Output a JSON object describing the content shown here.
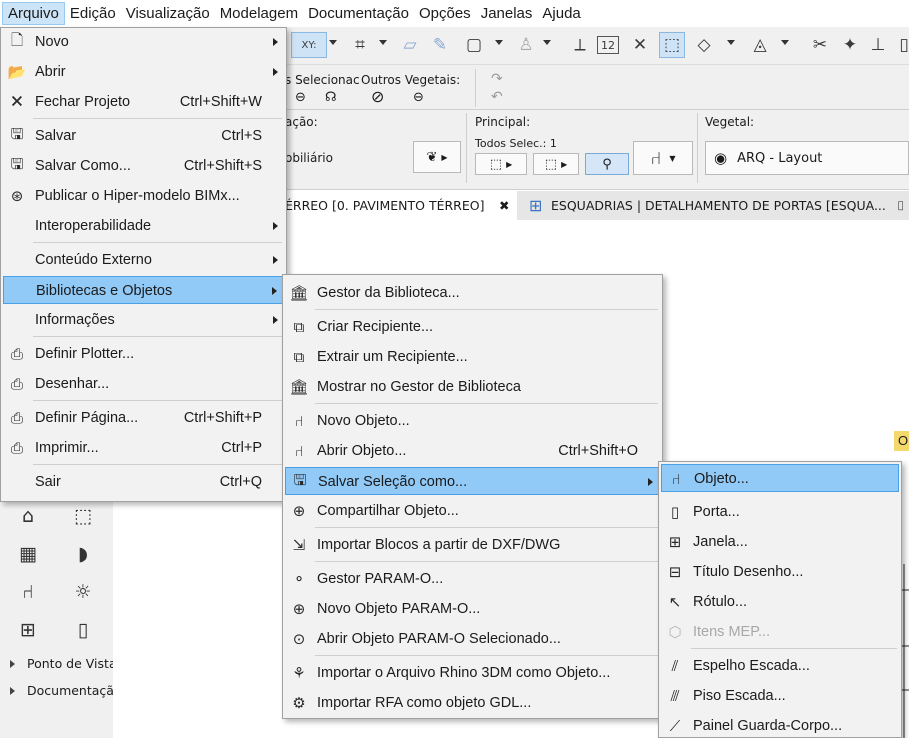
{
  "menubar": [
    {
      "label": "Arquivo",
      "active": true
    },
    {
      "label": "Edição"
    },
    {
      "label": "Visualização"
    },
    {
      "label": "Modelagem"
    },
    {
      "label": "Documentação"
    },
    {
      "label": "Opções"
    },
    {
      "label": "Janelas"
    },
    {
      "label": "Ajuda"
    }
  ],
  "toolbar": {
    "xy_label": "XY:",
    "calc_label": "12"
  },
  "infobox": {
    "sel_fragment": "s Selecionac",
    "outros_label": "Outros Vegetais:",
    "acao_fragment": "ação:",
    "principal_label": "Principal:",
    "todos_label": "Todos Selec.: 1",
    "vegetal_label": "Vegetal:",
    "mobiliario_fragment": "obiliário",
    "layer_value": "ARQ - Layout"
  },
  "tabs": {
    "tab1": "ÉRREO [0. PAVIMENTO TÉRREO]",
    "tab2": "ESQUADRIAS | DETALHAMENTO DE PORTAS [ESQUA..."
  },
  "left_panel": {
    "rows": [
      "Ponto de Vista",
      "Documentação"
    ]
  },
  "yellow_chip": "O",
  "file_menu": {
    "items": [
      {
        "label": "Novo",
        "icon": "new-document-icon",
        "submenu": true
      },
      {
        "label": "Abrir",
        "icon": "open-folder-icon",
        "submenu": true
      },
      {
        "label": "Fechar Projeto",
        "icon": "close-document-icon",
        "shortcut": "Ctrl+Shift+W"
      },
      {
        "label": "Salvar",
        "icon": "save-icon",
        "shortcut": "Ctrl+S"
      },
      {
        "label": "Salvar Como...",
        "icon": "save-as-icon",
        "shortcut": "Ctrl+Shift+S"
      },
      {
        "label": "Publicar o Hiper-modelo BIMx...",
        "icon": "bimx-icon"
      },
      {
        "label": "Interoperabilidade",
        "submenu": true
      },
      {
        "label": "Conteúdo Externo",
        "submenu": true
      },
      {
        "label": "Bibliotecas e Objetos",
        "submenu": true,
        "highlight": true
      },
      {
        "label": "Informações",
        "submenu": true
      },
      {
        "label": "Definir Plotter...",
        "icon": "plotter-setup-icon"
      },
      {
        "label": "Desenhar...",
        "icon": "plot-icon"
      },
      {
        "label": "Definir Página...",
        "icon": "page-setup-icon",
        "shortcut": "Ctrl+Shift+P"
      },
      {
        "label": "Imprimir...",
        "icon": "printer-icon",
        "shortcut": "Ctrl+P"
      },
      {
        "label": "Sair",
        "shortcut": "Ctrl+Q"
      }
    ]
  },
  "library_menu": {
    "items": [
      {
        "label": "Gestor da Biblioteca...",
        "icon": "library-manager-icon"
      },
      {
        "label": "Criar Recipiente...",
        "icon": "create-container-icon"
      },
      {
        "label": "Extrair um Recipiente...",
        "icon": "extract-container-icon"
      },
      {
        "label": "Mostrar no Gestor de Biblioteca",
        "icon": "show-in-library-icon"
      },
      {
        "label": "Novo Objeto...",
        "icon": "new-object-icon"
      },
      {
        "label": "Abrir Objeto...",
        "icon": "open-object-icon",
        "shortcut": "Ctrl+Shift+O"
      },
      {
        "label": "Salvar Seleção como...",
        "icon": "save-selection-icon",
        "submenu": true,
        "highlight": true
      },
      {
        "label": "Compartilhar Objeto...",
        "icon": "share-object-icon"
      },
      {
        "label": "Importar Blocos a partir de DXF/DWG",
        "icon": "import-dxf-icon"
      },
      {
        "label": "Gestor PARAM-O...",
        "icon": "param-o-manager-icon"
      },
      {
        "label": "Novo Objeto PARAM-O...",
        "icon": "param-o-new-icon"
      },
      {
        "label": "Abrir Objeto PARAM-O Selecionado...",
        "icon": "param-o-open-icon"
      },
      {
        "label": "Importar o Arquivo Rhino 3DM como Objeto...",
        "icon": "rhino-import-icon"
      },
      {
        "label": "Importar RFA como objeto GDL...",
        "icon": "rfa-import-icon"
      }
    ]
  },
  "save_as_menu": {
    "items": [
      {
        "label": "Objeto...",
        "icon": "chair-object-icon",
        "highlight": true
      },
      {
        "label": "Porta...",
        "icon": "door-icon"
      },
      {
        "label": "Janela...",
        "icon": "window-icon"
      },
      {
        "label": "Título Desenho...",
        "icon": "drawing-title-icon"
      },
      {
        "label": "Rótulo...",
        "icon": "label-icon"
      },
      {
        "label": "Itens MEP...",
        "icon": "mep-items-icon",
        "disabled": true
      },
      {
        "label": "Espelho Escada...",
        "icon": "stair-riser-icon"
      },
      {
        "label": "Piso Escada...",
        "icon": "stair-tread-icon"
      },
      {
        "label": "Painel Guarda-Corpo...",
        "icon": "railing-panel-icon"
      }
    ]
  }
}
